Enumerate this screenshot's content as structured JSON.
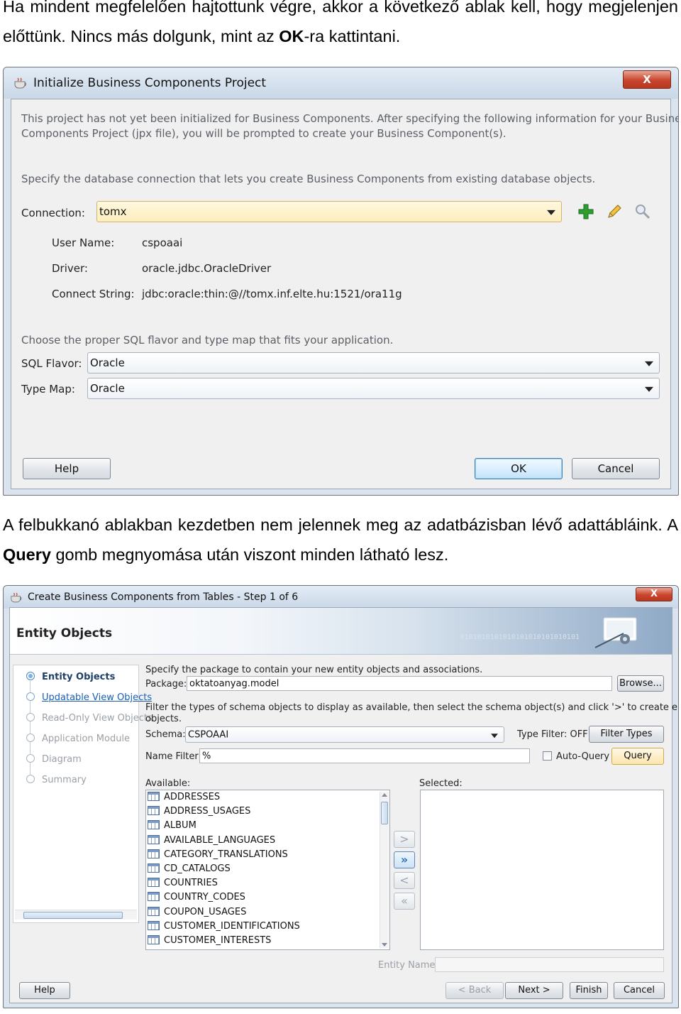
{
  "intro": {
    "text_a": "Ha mindent megfelelően hajtottunk végre, akkor a következő ablak kell, hogy megjelenjen előttünk. Nincs más dolgunk, mint az ",
    "bold": "OK",
    "text_b": "-ra kattintani."
  },
  "dialog1": {
    "title": "Initialize Business Components Project",
    "close_glyph": "X",
    "info_line1": "This project has not yet been initialized for Business Components.  After specifying the following information for your Business",
    "info_line2": "Components Project (jpx file), you will be prompted to create your Business Component(s).",
    "conn_info": "Specify the database connection that lets you create Business Components from existing database objects.",
    "connection_label": "Connection:",
    "connection_value": "tomx",
    "user_name_label": "User Name:",
    "user_name_value": "cspoaai",
    "driver_label": "Driver:",
    "driver_value": "oracle.jdbc.OracleDriver",
    "connect_string_label": "Connect String:",
    "connect_string_value": "jdbc:oracle:thin:@//tomx.inf.elte.hu:1521/ora11g",
    "sql_info": "Choose the proper SQL flavor and type map that fits your application.",
    "sql_flavor_label": "SQL Flavor:",
    "sql_flavor_value": "Oracle",
    "type_map_label": "Type Map:",
    "type_map_value": "Oracle",
    "help": "Help",
    "ok": "OK",
    "cancel": "Cancel",
    "icons": [
      "add-icon",
      "edit-icon",
      "search-icon"
    ],
    "colors": {
      "add": "#2e9e2e",
      "default_button_border": "#3c7fb1",
      "combo_highlight": "#fdeebc"
    }
  },
  "middle": {
    "text_a": "A felbukkanó ablakban kezdetben nem jelennek meg az adatbázisban lévő adattábláink. A ",
    "bold": "Query",
    "text_b": " gomb megnyomása után viszont minden látható lesz."
  },
  "dialog2": {
    "title": "Create Business Components from Tables - Step 1 of 6",
    "close_glyph": "X",
    "banner_title": "Entity Objects",
    "banner_digits": "0101010101010101010101010101",
    "nav": [
      {
        "label": "Entity Objects",
        "state": "current"
      },
      {
        "label": "Updatable View Objects",
        "state": "link"
      },
      {
        "label": "Read-Only View Objects",
        "state": "disabled"
      },
      {
        "label": "Application Module",
        "state": "disabled"
      },
      {
        "label": "Diagram",
        "state": "disabled"
      },
      {
        "label": "Summary",
        "state": "disabled"
      }
    ],
    "package_info": "Specify the package to contain your new entity objects and associations.",
    "package_label": "Package:",
    "package_value": "oktatoanyag.model",
    "browse": "Browse...",
    "filter_info1": "Filter the types of schema objects to display as available, then select the schema object(s) and click '>' to create entity",
    "filter_info2": "objects.",
    "schema_label": "Schema:",
    "schema_value": "CSPOAAI",
    "type_filter": "Type Filter: OFF",
    "filter_types": "Filter Types",
    "name_filter_label": "Name Filter:",
    "name_filter_value": "%",
    "auto_query": "Auto-Query",
    "query": "Query",
    "available_label": "Available:",
    "selected_label": "Selected:",
    "available": [
      "ADDRESSES",
      "ADDRESS_USAGES",
      "ALBUM",
      "AVAILABLE_LANGUAGES",
      "CATEGORY_TRANSLATIONS",
      "CD_CATALOGS",
      "COUNTRIES",
      "COUNTRY_CODES",
      "COUPON_USAGES",
      "CUSTOMER_IDENTIFICATIONS",
      "CUSTOMER_INTERESTS"
    ],
    "move_buttons": [
      ">",
      "»",
      "<",
      "«"
    ],
    "entity_name_label": "Entity Name:",
    "help": "Help",
    "back": "< Back",
    "next": "Next >",
    "finish": "Finish",
    "cancel": "Cancel"
  }
}
